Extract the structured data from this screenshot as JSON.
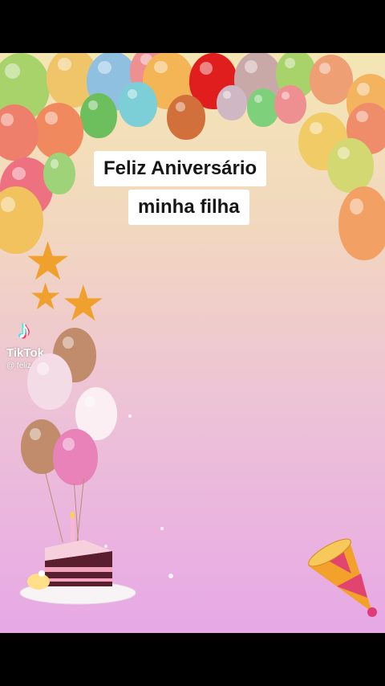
{
  "caption": {
    "line1": "Feliz Aniversário",
    "line2": "minha filha"
  },
  "watermark": {
    "brand": "TikTok",
    "handle": "@ felizaniversariooo",
    "icon": "tiktok-note-icon"
  },
  "colors": {
    "star": "#f0a12d",
    "caption_bg": "#ffffff",
    "frame_top": "#f4e6b4",
    "frame_bottom": "#e7a8e6"
  }
}
